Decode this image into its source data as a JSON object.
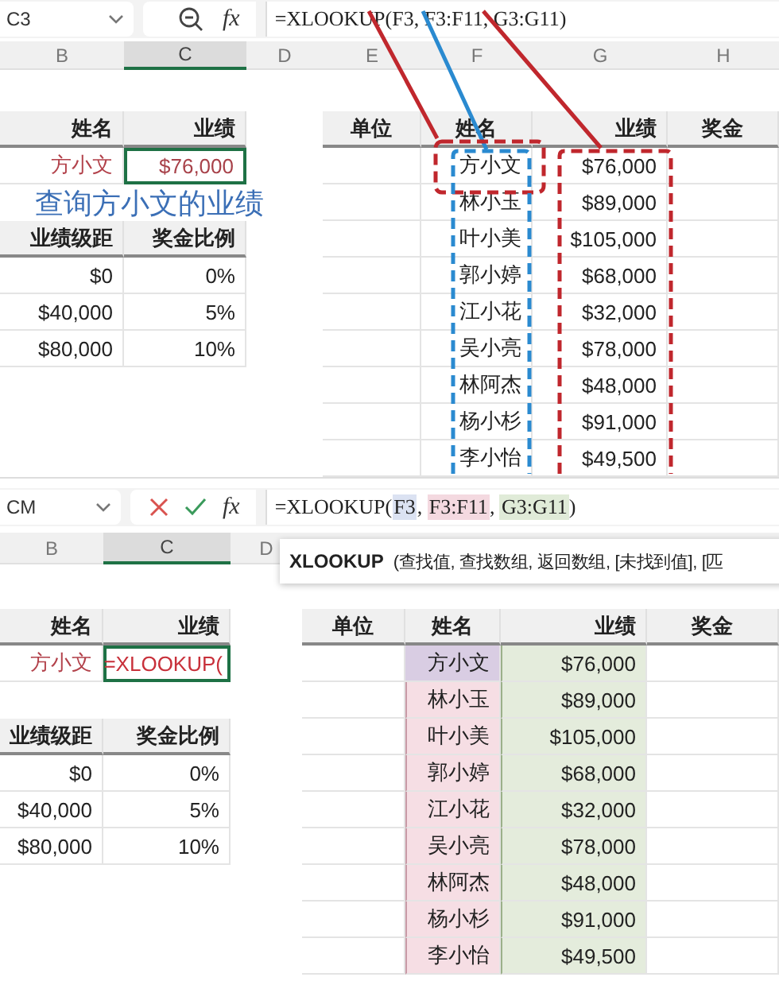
{
  "panels": [
    {
      "name_box": "C3",
      "toolbar": [
        {
          "kind": "zoom"
        },
        {
          "kind": "function",
          "label": "fx"
        }
      ],
      "formula": [
        {
          "text": "=XLOOKUP(F3, F3:F11, G3:G11)"
        }
      ],
      "columns": [
        {
          "label": "B",
          "selected": false
        },
        {
          "label": "C",
          "selected": true
        },
        {
          "label": "D",
          "selected": false
        },
        {
          "label": "E",
          "selected": false
        },
        {
          "label": "F",
          "selected": false
        },
        {
          "label": "G",
          "selected": false
        },
        {
          "label": "H",
          "selected": false
        }
      ],
      "result_table": {
        "columns": [
          "姓名",
          "业绩"
        ],
        "name": "方小文",
        "result": "$76,000",
        "editing": false
      },
      "note": "查询方小文的业绩",
      "bonus_table": {
        "columns": [
          "业绩级距",
          "奖金比例"
        ],
        "rows": [
          [
            "$0",
            "0%"
          ],
          [
            "$40,000",
            "5%"
          ],
          [
            "$80,000",
            "10%"
          ]
        ]
      },
      "data_table": {
        "columns": [
          "单位",
          "姓名",
          "业绩",
          "奖金"
        ],
        "range_highlight": false,
        "rows": [
          {
            "name": "方小文",
            "amount": "$76,000"
          },
          {
            "name": "林小玉",
            "amount": "$89,000"
          },
          {
            "name": "叶小美",
            "amount": "$105,000"
          },
          {
            "name": "郭小婷",
            "amount": "$68,000"
          },
          {
            "name": "江小花",
            "amount": "$32,000"
          },
          {
            "name": "吴小亮",
            "amount": "$78,000"
          },
          {
            "name": "林阿杰",
            "amount": "$48,000"
          },
          {
            "name": "杨小杉",
            "amount": "$91,000"
          },
          {
            "name": "李小怡",
            "amount": "$49,500"
          }
        ]
      },
      "callouts": true
    },
    {
      "name_box": "CM",
      "toolbar": [
        {
          "kind": "cancel"
        },
        {
          "kind": "enter"
        },
        {
          "kind": "function",
          "label": "fx"
        }
      ],
      "formula": [
        {
          "text": "=XLOOKUP("
        },
        {
          "text": "F3",
          "color": "#dbe2f2"
        },
        {
          "text": ", "
        },
        {
          "text": "F3:F11",
          "color": "#f4d9e0"
        },
        {
          "text": ", "
        },
        {
          "text": "G3:G11",
          "color": "#e0ebd8"
        },
        {
          "text": ")"
        }
      ],
      "columns": [
        {
          "label": "B",
          "selected": false
        },
        {
          "label": "C",
          "selected": true
        },
        {
          "label": "D",
          "selected": false
        }
      ],
      "tooltip": {
        "function": "XLOOKUP",
        "args": "(查找值, 查找数组, 返回数组, [未找到值], [匹"
      },
      "result_table": {
        "columns": [
          "姓名",
          "业绩"
        ],
        "name": "方小文",
        "result": "=XLOOKUP(",
        "editing": true
      },
      "bonus_table": {
        "columns": [
          "业绩级距",
          "奖金比例"
        ],
        "rows": [
          [
            "$0",
            "0%"
          ],
          [
            "$40,000",
            "5%"
          ],
          [
            "$80,000",
            "10%"
          ]
        ]
      },
      "data_table": {
        "columns": [
          "单位",
          "姓名",
          "业绩",
          "奖金"
        ],
        "range_highlight": true,
        "rows": [
          {
            "name": "方小文",
            "amount": "$76,000"
          },
          {
            "name": "林小玉",
            "amount": "$89,000"
          },
          {
            "name": "叶小美",
            "amount": "$105,000"
          },
          {
            "name": "郭小婷",
            "amount": "$68,000"
          },
          {
            "name": "江小花",
            "amount": "$32,000"
          },
          {
            "name": "吴小亮",
            "amount": "$78,000"
          },
          {
            "name": "林阿杰",
            "amount": "$48,000"
          },
          {
            "name": "杨小杉",
            "amount": "$91,000"
          },
          {
            "name": "李小怡",
            "amount": "$49,500"
          }
        ]
      }
    }
  ]
}
